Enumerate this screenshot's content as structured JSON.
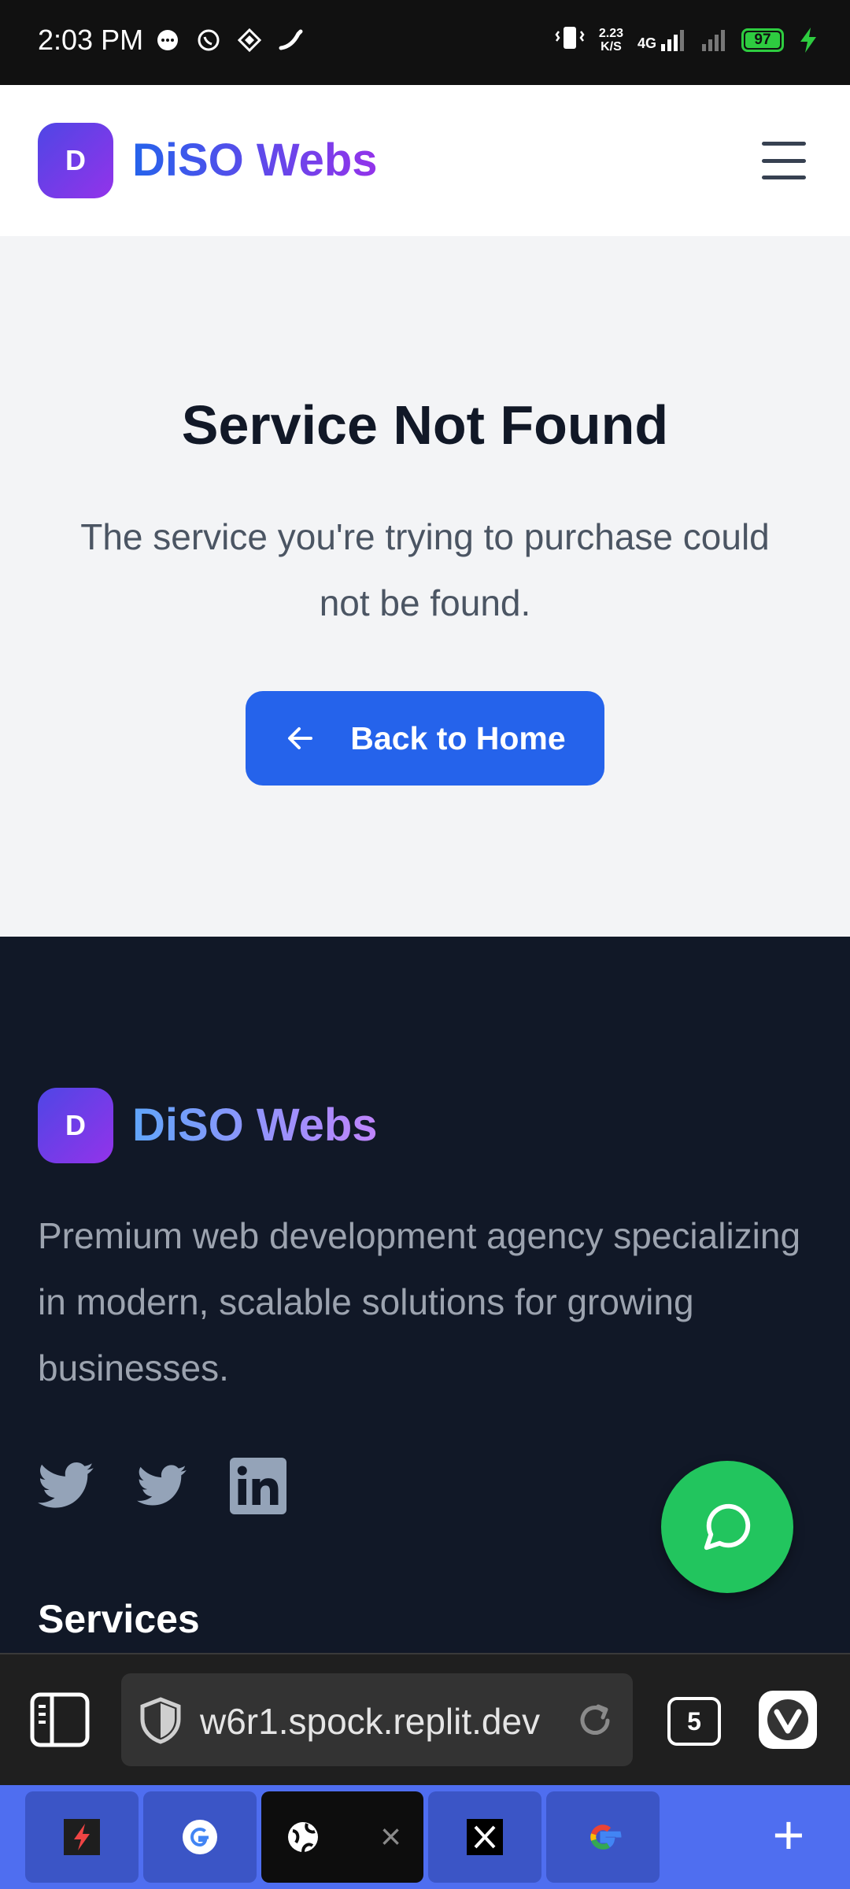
{
  "status_bar": {
    "time": "2:03 PM",
    "speed_value": "2.23",
    "speed_unit": "K/S",
    "network": "4G",
    "battery": "97"
  },
  "header": {
    "logo_letter": "D",
    "brand": "DiSO Webs"
  },
  "main": {
    "title": "Service Not Found",
    "description": "The service you're trying to purchase could not be found.",
    "back_button_label": "Back to Home"
  },
  "footer": {
    "logo_letter": "D",
    "brand": "DiSO Webs",
    "description": "Premium web development agency specializing in modern, scalable solutions for growing businesses.",
    "services_heading": "Services",
    "socials": [
      "twitter-icon",
      "twitter-icon",
      "linkedin-icon"
    ]
  },
  "browser": {
    "url": "w6r1.spock.replit.dev",
    "tab_count": "5"
  },
  "colors": {
    "primary": "#2563eb",
    "brand_gradient_start": "#2563eb",
    "brand_gradient_end": "#9333ea",
    "footer_bg": "#111827",
    "chat_fab": "#22c55e",
    "tabstrip": "#4f6ef0"
  }
}
